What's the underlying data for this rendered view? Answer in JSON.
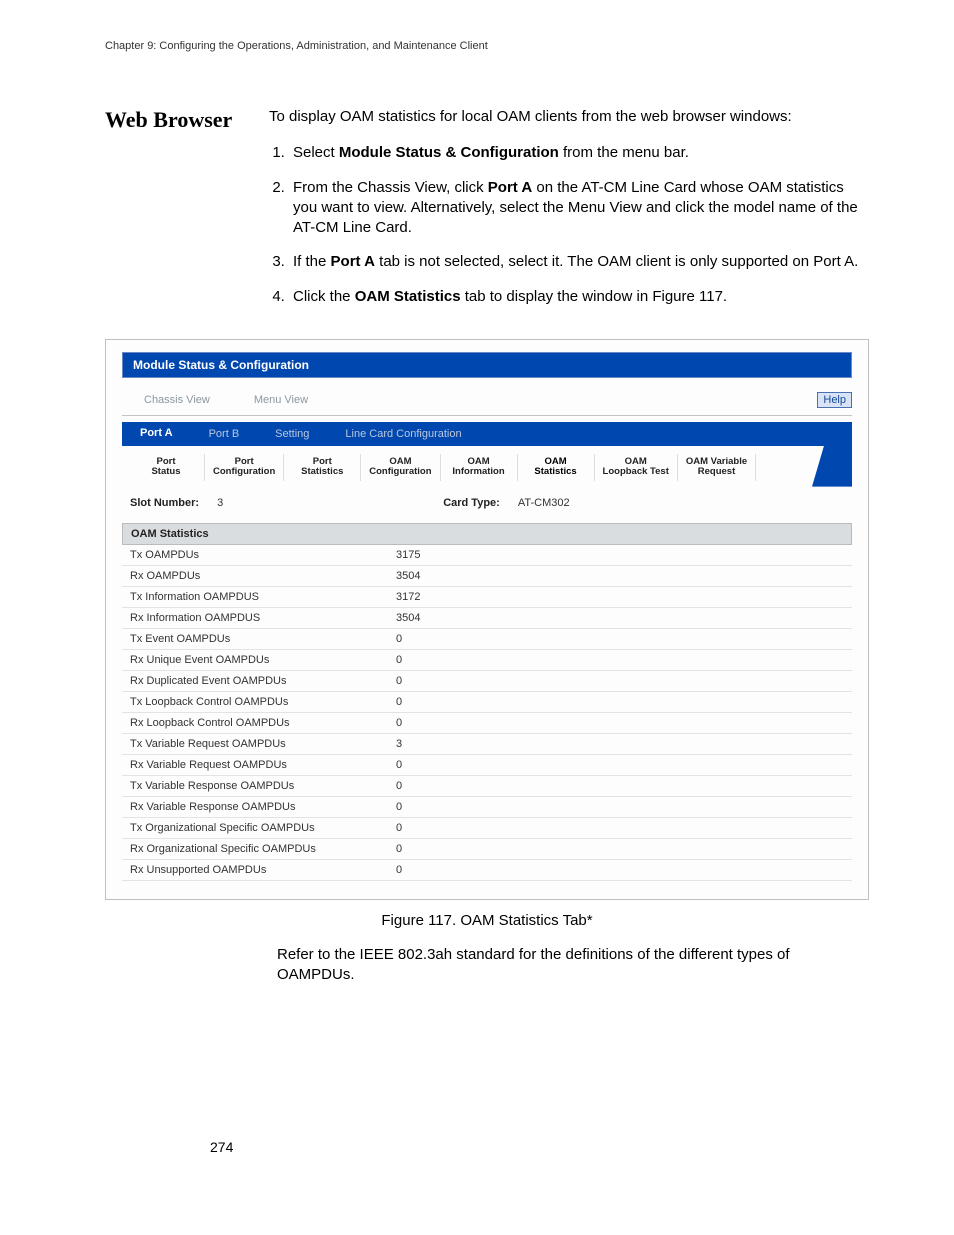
{
  "chapter_header": "Chapter 9: Configuring the Operations, Administration, and Maintenance Client",
  "section_title": "Web Browser",
  "intro": "To display OAM statistics for local OAM clients from the web browser windows:",
  "steps": [
    {
      "pre": "Select ",
      "bold": "Module Status & Configuration",
      "post": " from the menu bar."
    },
    {
      "pre": "From the Chassis View, click ",
      "bold": "Port A",
      "post": " on the AT-CM Line Card whose OAM statistics you want to view. Alternatively, select the Menu View and click the model name of the AT-CM Line Card."
    },
    {
      "pre": "If the ",
      "bold": "Port A",
      "post": " tab is not selected, select it. The OAM client is only supported on Port A."
    },
    {
      "pre": "Click the ",
      "bold": "OAM Statistics",
      "post": " tab to display the window in Figure 117."
    }
  ],
  "ui": {
    "module_title": "Module Status & Configuration",
    "nav": {
      "chassis": "Chassis View",
      "menu": "Menu View",
      "help": "Help"
    },
    "port_tabs": [
      "Port A",
      "Port B",
      "Setting",
      "Line Card Configuration"
    ],
    "sub_tabs": [
      "Port\nStatus",
      "Port\nConfiguration",
      "Port\nStatistics",
      "OAM\nConfiguration",
      "OAM\nInformation",
      "OAM\nStatistics",
      "OAM\nLoopback Test",
      "OAM Variable\nRequest"
    ],
    "slot_label": "Slot Number:",
    "slot_value": "3",
    "card_label": "Card Type:",
    "card_value": "AT-CM302",
    "stats_header": "OAM Statistics",
    "stats": [
      {
        "label": "Tx OAMPDUs",
        "value": "3175"
      },
      {
        "label": "Rx OAMPDUs",
        "value": "3504"
      },
      {
        "label": "Tx Information OAMPDUS",
        "value": "3172"
      },
      {
        "label": "Rx Information OAMPDUS",
        "value": "3504"
      },
      {
        "label": "Tx Event OAMPDUs",
        "value": "0"
      },
      {
        "label": "Rx Unique Event OAMPDUs",
        "value": "0"
      },
      {
        "label": "Rx Duplicated Event OAMPDUs",
        "value": "0"
      },
      {
        "label": "Tx Loopback Control OAMPDUs",
        "value": "0"
      },
      {
        "label": "Rx Loopback Control OAMPDUs",
        "value": "0"
      },
      {
        "label": "Tx Variable Request OAMPDUs",
        "value": "3"
      },
      {
        "label": "Rx Variable Request OAMPDUs",
        "value": "0"
      },
      {
        "label": "Tx Variable Response OAMPDUs",
        "value": "0"
      },
      {
        "label": "Rx Variable Response OAMPDUs",
        "value": "0"
      },
      {
        "label": "Tx Organizational Specific OAMPDUs",
        "value": "0"
      },
      {
        "label": "Rx Organizational Specific OAMPDUs",
        "value": "0"
      },
      {
        "label": "Rx Unsupported OAMPDUs",
        "value": "0"
      }
    ]
  },
  "figure_caption": "Figure 117. OAM Statistics Tab*",
  "below_text": "Refer to the IEEE 802.3ah standard for the definitions of the different types of OAMPDUs.",
  "page_number": "274"
}
